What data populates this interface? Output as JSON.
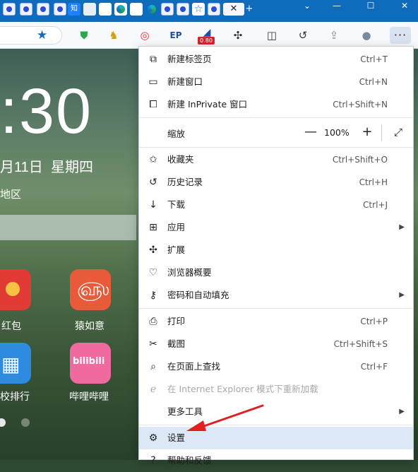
{
  "tabs": {
    "zhihu_label": "知",
    "close_glyph": "✕",
    "new_tab_glyph": "+"
  },
  "window": {
    "minimize_glyph": "—",
    "maximize_glyph": "☐",
    "close_glyph": "✕",
    "chevron_glyph": "⌄"
  },
  "toolbar": {
    "favorite_glyph": "★",
    "badge_value": "0.80",
    "more_glyph": "···"
  },
  "newtab": {
    "clock": ":30",
    "date": "月11日",
    "weekday": "星期四",
    "region": "地区",
    "apps": [
      {
        "label": "红包"
      },
      {
        "label": "猿如意"
      },
      {
        "label": "校排行"
      },
      {
        "label": "哔哩哔哩"
      }
    ],
    "bilibili_logo_text": "bilibili"
  },
  "menu": {
    "new_tab": {
      "label": "新建标签页",
      "shortcut": "Ctrl+T"
    },
    "new_window": {
      "label": "新建窗口",
      "shortcut": "Ctrl+N"
    },
    "new_inprivate": {
      "label": "新建 InPrivate 窗口",
      "shortcut": "Ctrl+Shift+N"
    },
    "zoom": {
      "label": "缩放",
      "value": "100%",
      "minus": "—",
      "plus": "+"
    },
    "favorites": {
      "label": "收藏夹",
      "shortcut": "Ctrl+Shift+O"
    },
    "history": {
      "label": "历史记录",
      "shortcut": "Ctrl+H"
    },
    "downloads": {
      "label": "下载",
      "shortcut": "Ctrl+J"
    },
    "apps": {
      "label": "应用"
    },
    "extensions": {
      "label": "扩展"
    },
    "essentials": {
      "label": "浏览器概要"
    },
    "passwords": {
      "label": "密码和自动填充"
    },
    "print": {
      "label": "打印",
      "shortcut": "Ctrl+P"
    },
    "screenshot": {
      "label": "截图",
      "shortcut": "Ctrl+Shift+S"
    },
    "find": {
      "label": "在页面上查找",
      "shortcut": "Ctrl+F"
    },
    "ie_reload": {
      "label": "在 Internet Explorer 模式下重新加载"
    },
    "more_tools": {
      "label": "更多工具"
    },
    "settings": {
      "label": "设置"
    },
    "help": {
      "label": "帮助和反馈"
    }
  },
  "colors": {
    "titlebar": "#0f6cbd",
    "menu_highlight": "#dde8f6",
    "annotation_arrow": "#e02020"
  }
}
